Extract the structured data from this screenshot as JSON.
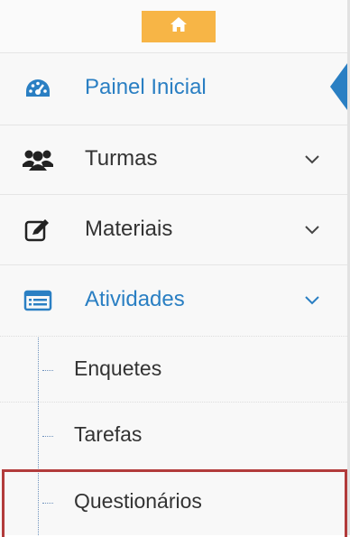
{
  "menu": {
    "home_icon": "home-icon",
    "items": [
      {
        "label": "Painel Inicial",
        "icon": "dashboard-icon",
        "active": true
      },
      {
        "label": "Turmas",
        "icon": "users-icon"
      },
      {
        "label": "Materiais",
        "icon": "edit-icon"
      },
      {
        "label": "Atividades",
        "icon": "list-icon",
        "active": true
      }
    ],
    "submenu": [
      {
        "label": "Enquetes"
      },
      {
        "label": "Tarefas"
      },
      {
        "label": "Questionários",
        "highlighted": true
      }
    ]
  },
  "colors": {
    "accent": "#2a7fc3",
    "home_button": "#f7b546",
    "highlight_border": "#b23b3b"
  }
}
